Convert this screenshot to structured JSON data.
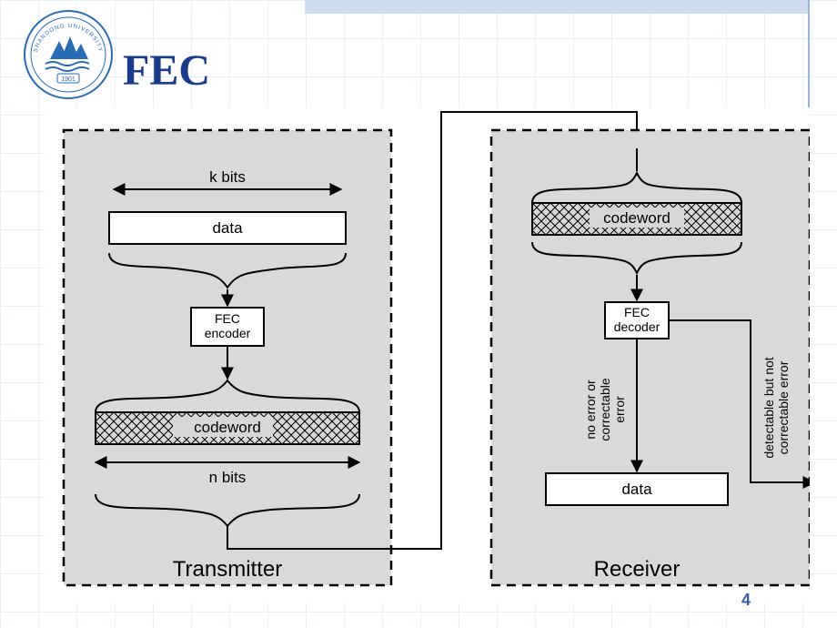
{
  "title": "FEC",
  "logo": {
    "org": "SHANDONG UNIVERSITY",
    "year": "1901"
  },
  "page_number": "4",
  "diagram": {
    "transmitter": {
      "title": "Transmitter",
      "k_bits_label": "k bits",
      "data_label": "data",
      "encoder_label_line1": "FEC",
      "encoder_label_line2": "encoder",
      "codeword_label": "codeword",
      "n_bits_label": "n bits"
    },
    "receiver": {
      "title": "Receiver",
      "codeword_label": "codeword",
      "decoder_label_line1": "FEC",
      "decoder_label_line2": "decoder",
      "branch_ok": "no error or correctable error",
      "branch_bad": "detectable but not correctable error",
      "data_label": "data"
    }
  }
}
